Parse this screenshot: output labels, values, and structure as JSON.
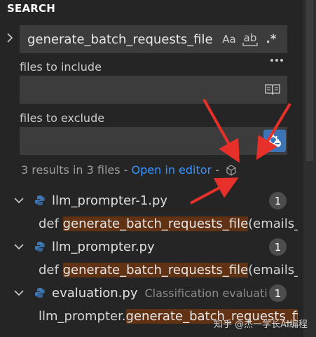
{
  "panel": {
    "title": "SEARCH"
  },
  "search": {
    "query": "generate_batch_requests_file",
    "match_case_label": "Aa",
    "whole_word_label": "ab",
    "regex_label": ".*"
  },
  "include": {
    "label": "files to include",
    "value": ""
  },
  "exclude": {
    "label": "files to exclude",
    "value": ""
  },
  "summary": {
    "results_text": "3 results in 3 files - ",
    "open_in_editor": "Open in editor",
    "separator": " - "
  },
  "results": [
    {
      "file": "llm_prompter-1.py",
      "description": "",
      "count": "1",
      "match_prefix": "def ",
      "match_highlight": "generate_batch_requests_file",
      "match_suffix": "(emails_..."
    },
    {
      "file": "llm_prompter.py",
      "description": "",
      "count": "1",
      "match_prefix": "def ",
      "match_highlight": "generate_batch_requests_file",
      "match_suffix": "(emails_..."
    },
    {
      "file": "evaluation.py",
      "description": "Classification evaluati...",
      "count": "1",
      "match_prefix": "llm_prompter.",
      "match_highlight": "generate_batch_requests_fil",
      "match_suffix": ""
    }
  ],
  "watermark": "知乎 @杰一学长AI编程",
  "colors": {
    "background": "#252526",
    "input": "#3c3c3c",
    "link": "#3794ff",
    "highlight": "#613214",
    "active_button": "#3b75b8",
    "annotation_arrow": "#e8302a"
  }
}
